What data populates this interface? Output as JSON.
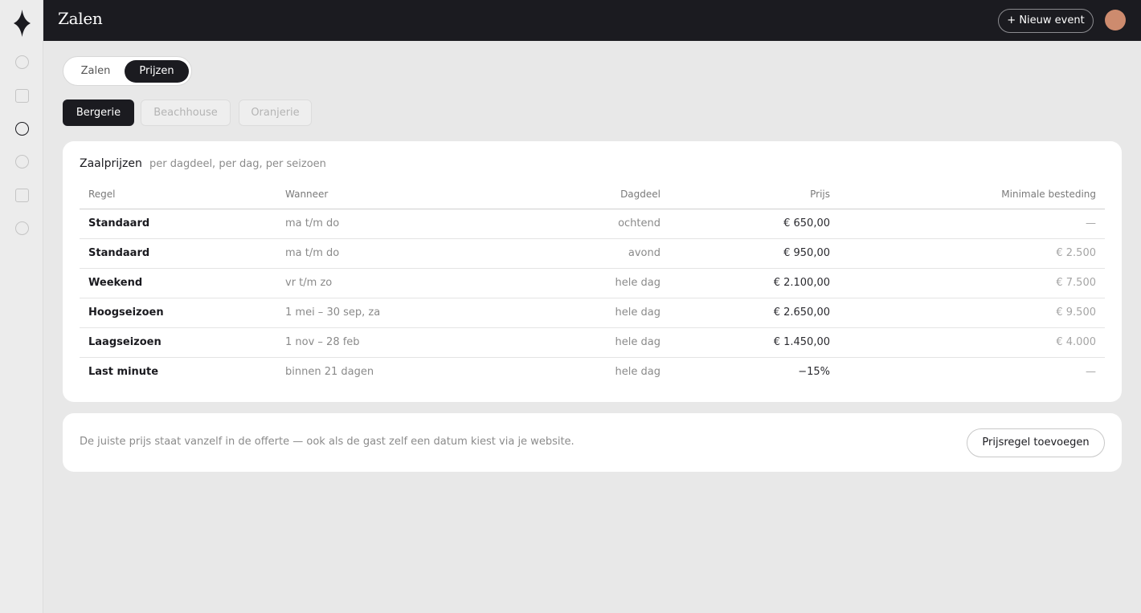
{
  "header": {
    "title": "Zalen",
    "new_event_label": "+ Nieuw event"
  },
  "view_toggle": {
    "options": [
      "Zalen",
      "Prijzen"
    ],
    "selected": "Prijzen"
  },
  "rooms": {
    "tabs": [
      "Bergerie",
      "Beachhouse",
      "Oranjerie"
    ],
    "selected": "Bergerie"
  },
  "pricing": {
    "title": "Zaalprijzen",
    "subtitle": "per dagdeel, per dag, per seizoen",
    "columns": [
      "Regel",
      "Wanneer",
      "Dagdeel",
      "Prijs",
      "Minimale besteding"
    ],
    "rows": [
      {
        "regel": "Standaard",
        "wanneer": "ma t/m do",
        "dagdeel": "ochtend",
        "prijs": "€ 650,00",
        "min": "—"
      },
      {
        "regel": "Standaard",
        "wanneer": "ma t/m do",
        "dagdeel": "avond",
        "prijs": "€ 950,00",
        "min": "€ 2.500"
      },
      {
        "regel": "Weekend",
        "wanneer": "vr t/m zo",
        "dagdeel": "hele dag",
        "prijs": "€ 2.100,00",
        "min": "€ 7.500"
      },
      {
        "regel": "Hoogseizoen",
        "wanneer": "1 mei – 30 sep, za",
        "dagdeel": "hele dag",
        "prijs": "€ 2.650,00",
        "min": "€ 9.500"
      },
      {
        "regel": "Laagseizoen",
        "wanneer": "1 nov – 28 feb",
        "dagdeel": "hele dag",
        "prijs": "€ 1.450,00",
        "min": "€ 4.000"
      },
      {
        "regel": "Last minute",
        "wanneer": "binnen 21 dagen",
        "dagdeel": "hele dag",
        "prijs": "−15%",
        "min": "—"
      }
    ]
  },
  "footer": {
    "hint": "De juiste prijs staat vanzelf in de offerte — ook als de gast zelf een datum kiest via je website.",
    "add_label": "Prijsregel toevoegen"
  },
  "icons": {
    "logo": "diamond-logo-icon",
    "nav": [
      "circle-icon",
      "square-icon",
      "circle-icon",
      "circle-icon",
      "square-icon",
      "circle-icon"
    ]
  },
  "colors": {
    "dark": "#1b1b20",
    "avatar": "#cd8b6e",
    "background": "#e8e8e8"
  }
}
